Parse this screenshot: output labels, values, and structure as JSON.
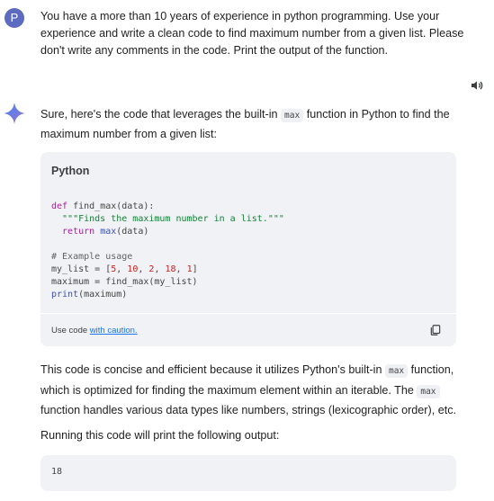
{
  "user": {
    "avatar_letter": "P",
    "prompt": "You have a more than 10 years of experience in python programming. Use your experience and write a clean code to find maximum number from a given list. Please don't write any comments in the code. Print the output of the function."
  },
  "response": {
    "intro_before": "Sure, here's the code that leverages the built-in ",
    "intro_code": "max",
    "intro_after": " function in Python to find the maximum number from a given list:",
    "code_block": {
      "language": "Python",
      "lines": {
        "l1_kw": "def ",
        "l1_rest": "find_max(data):",
        "l2": "  \"\"\"Finds the maximum number in a list.\"\"\"",
        "l3_kw": "  return ",
        "l3_bi": "max",
        "l3_rest": "(data)",
        "l4": "# Example usage",
        "l5_a": "my_list = [",
        "l5_n1": "5",
        "l5_s1": ", ",
        "l5_n2": "10",
        "l5_s2": ", ",
        "l5_n3": "2",
        "l5_s3": ", ",
        "l5_n4": "18",
        "l5_s4": ", ",
        "l5_n5": "1",
        "l5_b": "]",
        "l6": "maximum = find_max(my_list)",
        "l7_bi": "print",
        "l7_rest": "(maximum)"
      },
      "footer_text": "Use code ",
      "footer_link": "with caution."
    },
    "para1_a": "This code is concise and efficient because it utilizes Python's built-in ",
    "para1_code1": "max",
    "para1_b": " function, which is optimized for finding the maximum element within an iterable. The ",
    "para1_code2": "max",
    "para1_c": " function handles various data types like numbers, strings (lexicographic order), etc.",
    "para2": "Running this code will print the following output:",
    "output": "18"
  },
  "colors": {
    "avatar": "#5c6bc0",
    "card_bg": "#f0f2f6",
    "link": "#1a73e8",
    "spark_blue": "#4285f4"
  }
}
